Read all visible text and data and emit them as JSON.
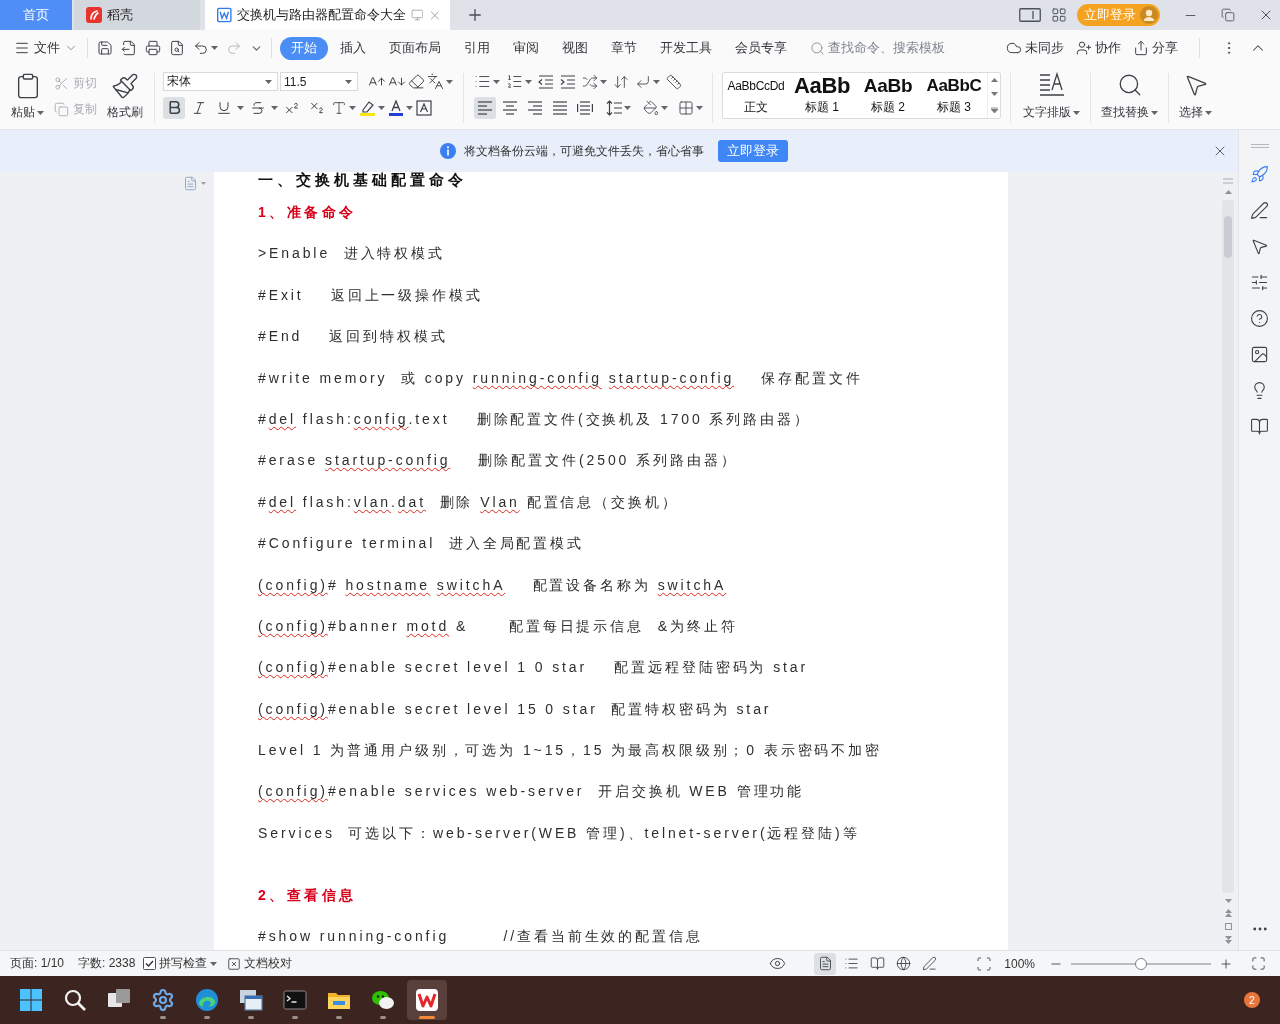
{
  "tabs": [
    {
      "kind": "home",
      "label": "首页",
      "selected": false
    },
    {
      "kind": "docer",
      "label": "稻壳",
      "selected": false
    },
    {
      "kind": "document",
      "label": "交换机与路由器配置命令大全",
      "selected": true
    }
  ],
  "title_bar": {
    "login_button": "立即登录"
  },
  "menu_bar": {
    "file_menu": "文件",
    "quick_access": [
      {
        "kind": "save",
        "disabled": false
      },
      {
        "kind": "export",
        "disabled": false
      },
      {
        "kind": "print",
        "disabled": false
      },
      {
        "kind": "preview",
        "disabled": false
      },
      {
        "kind": "undo",
        "disabled": false
      },
      {
        "kind": "redo",
        "disabled": true
      }
    ],
    "tabs": [
      {
        "label": "开始",
        "selected": true
      },
      {
        "label": "插入",
        "selected": false
      },
      {
        "label": "页面布局",
        "selected": false
      },
      {
        "label": "引用",
        "selected": false
      },
      {
        "label": "审阅",
        "selected": false
      },
      {
        "label": "视图",
        "selected": false
      },
      {
        "label": "章节",
        "selected": false
      },
      {
        "label": "开发工具",
        "selected": false
      },
      {
        "label": "会员专享",
        "selected": false
      }
    ],
    "search": {
      "placeholder": "查找命令、搜索模板"
    },
    "actions": [
      {
        "kind": "sync",
        "label": "未同步"
      },
      {
        "kind": "collaborate",
        "label": "协作"
      },
      {
        "kind": "share",
        "label": "分享"
      }
    ]
  },
  "ribbon": {
    "clipboard": [
      {
        "kind": "paste",
        "label": "粘贴",
        "disabled": false
      },
      {
        "kind": "cut",
        "label": "剪切",
        "disabled": true
      },
      {
        "kind": "copy",
        "label": "复制",
        "disabled": true
      },
      {
        "kind": "format_painter",
        "label": "格式刷",
        "disabled": false
      }
    ],
    "font": {
      "family": "宋体",
      "size": "11.5",
      "toggles": [
        {
          "kind": "bold",
          "on": true
        },
        {
          "kind": "italic",
          "on": false
        },
        {
          "kind": "underline",
          "on": false
        },
        {
          "kind": "strikethrough",
          "on": false
        },
        {
          "kind": "superscript",
          "on": false
        },
        {
          "kind": "subscript",
          "on": false
        }
      ]
    },
    "alignment": [
      {
        "kind": "left",
        "selected": true
      },
      {
        "kind": "center",
        "selected": false
      },
      {
        "kind": "right",
        "selected": false
      },
      {
        "kind": "justify",
        "selected": false
      },
      {
        "kind": "distributed",
        "selected": false
      }
    ],
    "styles": [
      {
        "kind": "normal",
        "preview": "AaBbCcDd",
        "label": "正文"
      },
      {
        "kind": "heading1",
        "preview": "AaBb",
        "label": "标题 1"
      },
      {
        "kind": "heading2",
        "preview": "AaBb",
        "label": "标题 2"
      },
      {
        "kind": "heading3",
        "preview": "AaBbC",
        "label": "标题 3"
      }
    ],
    "tools": [
      {
        "kind": "text_layout",
        "label": "文字排版"
      },
      {
        "kind": "find_replace",
        "label": "查找替换"
      },
      {
        "kind": "select",
        "label": "选择"
      }
    ]
  },
  "notice": {
    "text": "将文档备份云端，可避免文件丢失，省心省事",
    "button": "立即登录"
  },
  "document": {
    "paragraphs": [
      {
        "kind": "heading1",
        "parts": [
          {
            "text": "一、交换机基础配置命令",
            "misspelled": false
          }
        ]
      },
      {
        "kind": "heading2",
        "parts": [
          {
            "text": "1、准备命令",
            "misspelled": false
          }
        ]
      },
      {
        "kind": "body",
        "parts": [
          {
            "text": ">Enable  进入特权模式",
            "misspelled": false
          }
        ]
      },
      {
        "kind": "body",
        "parts": [
          {
            "text": "#Exit    返回上一级操作模式",
            "misspelled": false
          }
        ]
      },
      {
        "kind": "body",
        "parts": [
          {
            "text": "#End    返回到特权模式",
            "misspelled": false
          }
        ]
      },
      {
        "kind": "body",
        "parts": [
          {
            "text": "#write memory  或 copy ",
            "misspelled": false
          },
          {
            "text": "running-config ",
            "misspelled": true
          },
          {
            "text": "startup-config",
            "misspelled": true
          },
          {
            "text": "    保存配置文件",
            "misspelled": false
          }
        ]
      },
      {
        "kind": "body",
        "parts": [
          {
            "text": "#",
            "misspelled": false
          },
          {
            "text": "del",
            "misspelled": true
          },
          {
            "text": " flash:",
            "misspelled": false
          },
          {
            "text": "config",
            "misspelled": true
          },
          {
            "text": ".text    删除配置文件(交换机及 1700 系列路由器）",
            "misspelled": false
          }
        ]
      },
      {
        "kind": "body",
        "parts": [
          {
            "text": "#erase ",
            "misspelled": false
          },
          {
            "text": "startup-config",
            "misspelled": true
          },
          {
            "text": "    删除配置文件(2500 系列路由器）",
            "misspelled": false
          }
        ]
      },
      {
        "kind": "body",
        "parts": [
          {
            "text": "#",
            "misspelled": false
          },
          {
            "text": "del",
            "misspelled": true
          },
          {
            "text": " flash:",
            "misspelled": false
          },
          {
            "text": "vlan",
            "misspelled": true
          },
          {
            "text": ".",
            "misspelled": false
          },
          {
            "text": "dat",
            "misspelled": true
          },
          {
            "text": "  删除 ",
            "misspelled": false
          },
          {
            "text": "Vlan",
            "misspelled": true
          },
          {
            "text": " 配置信息（交换机）",
            "misspelled": false
          }
        ]
      },
      {
        "kind": "body",
        "parts": [
          {
            "text": "#Configure terminal  进入全局配置模式",
            "misspelled": false
          }
        ]
      },
      {
        "kind": "body",
        "parts": [
          {
            "text": "(config)",
            "misspelled": true
          },
          {
            "text": "# ",
            "misspelled": false
          },
          {
            "text": "hostname ",
            "misspelled": true
          },
          {
            "text": "switchA",
            "misspelled": true
          },
          {
            "text": "    配置设备名称为 ",
            "misspelled": false
          },
          {
            "text": "switchA",
            "misspelled": true
          }
        ]
      },
      {
        "kind": "body",
        "parts": [
          {
            "text": "(config)",
            "misspelled": true
          },
          {
            "text": "#banner ",
            "misspelled": false
          },
          {
            "text": "motd",
            "misspelled": true
          },
          {
            "text": " &      配置每日提示信息  &为终止符",
            "misspelled": false
          }
        ]
      },
      {
        "kind": "body",
        "parts": [
          {
            "text": "(config)",
            "misspelled": true
          },
          {
            "text": "#enable secret level 1 0 star    配置远程登陆密码为 star",
            "misspelled": false
          }
        ]
      },
      {
        "kind": "body",
        "parts": [
          {
            "text": "(config)",
            "misspelled": true
          },
          {
            "text": "#enable secret level 15 0 star  配置特权密码为 star",
            "misspelled": false
          }
        ]
      },
      {
        "kind": "body",
        "parts": [
          {
            "text": "Level 1 为普通用户级别，可选为 1~15，15 为最高权限级别；0 表示密码不加密",
            "misspelled": false
          }
        ]
      },
      {
        "kind": "body",
        "parts": [
          {
            "text": "(config)",
            "misspelled": true
          },
          {
            "text": "#enable services web-server  开启交换机 WEB 管理功能",
            "misspelled": false
          }
        ]
      },
      {
        "kind": "body",
        "parts": [
          {
            "text": "Services  可选以下：web-server(WEB 管理)、telnet-server(远程登陆)等",
            "misspelled": false
          }
        ]
      },
      {
        "kind": "heading2",
        "parts": [
          {
            "text": "2、查看信息",
            "misspelled": false
          }
        ]
      },
      {
        "kind": "body",
        "parts": [
          {
            "text": "#show running-config        //查看当前生效的配置信息",
            "misspelled": false
          }
        ]
      }
    ]
  },
  "status_bar": {
    "page": "页面: 1/10",
    "words": "字数: 2338",
    "spell_check": {
      "label": "拼写检查",
      "checked": true
    },
    "proofread": "文档校对",
    "view_modes": [
      {
        "kind": "page",
        "selected": true
      },
      {
        "kind": "outline",
        "selected": false
      },
      {
        "kind": "reading",
        "selected": false
      },
      {
        "kind": "web",
        "selected": false
      },
      {
        "kind": "writing",
        "selected": false
      }
    ],
    "zoom": {
      "reading": "100%",
      "level": 0.5
    }
  },
  "taskbar": {
    "apps": [
      {
        "kind": "start",
        "running": false,
        "selected": false
      },
      {
        "kind": "search",
        "running": false,
        "selected": false
      },
      {
        "kind": "task_view",
        "running": false,
        "selected": false
      },
      {
        "kind": "settings",
        "running": true,
        "selected": false
      },
      {
        "kind": "browser",
        "running": true,
        "selected": false
      },
      {
        "kind": "remote",
        "running": true,
        "selected": false
      },
      {
        "kind": "terminal",
        "running": true,
        "selected": false
      },
      {
        "kind": "explorer",
        "running": true,
        "selected": false
      },
      {
        "kind": "chat",
        "running": true,
        "selected": false
      },
      {
        "kind": "office",
        "running": true,
        "selected": true
      }
    ],
    "badge": "2"
  }
}
